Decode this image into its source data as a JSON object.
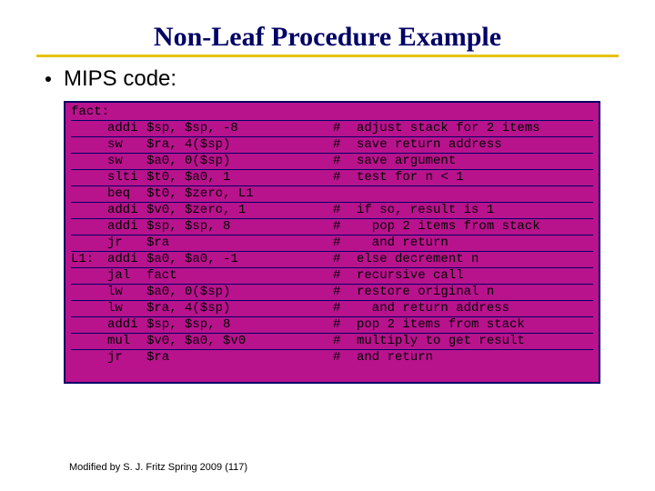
{
  "title": "Non-Leaf Procedure Example",
  "bullet": "MIPS code:",
  "code": {
    "rows": [
      {
        "label": "fact:",
        "op": "",
        "args": "",
        "hash": "",
        "comment": ""
      },
      {
        "label": "",
        "op": "addi",
        "args": "$sp, $sp, -8",
        "hash": "#",
        "comment": "adjust stack for 2 items"
      },
      {
        "label": "",
        "op": "sw",
        "args": "$ra, 4($sp)",
        "hash": "#",
        "comment": "save return address"
      },
      {
        "label": "",
        "op": "sw",
        "args": "$a0, 0($sp)",
        "hash": "#",
        "comment": "save argument"
      },
      {
        "label": "",
        "op": "slti",
        "args": "$t0, $a0, 1",
        "hash": "#",
        "comment": "test for n < 1"
      },
      {
        "label": "",
        "op": "beq",
        "args": "$t0, $zero, L1",
        "hash": "",
        "comment": ""
      },
      {
        "label": "",
        "op": "addi",
        "args": "$v0, $zero, 1",
        "hash": "#",
        "comment": "if so, result is 1"
      },
      {
        "label": "",
        "op": "addi",
        "args": "$sp, $sp, 8",
        "hash": "#",
        "comment": "  pop 2 items from stack"
      },
      {
        "label": "",
        "op": "jr",
        "args": "$ra",
        "hash": "#",
        "comment": "  and return"
      },
      {
        "label": "L1:",
        "op": "addi",
        "args": "$a0, $a0, -1",
        "hash": "#",
        "comment": "else decrement n"
      },
      {
        "label": "",
        "op": "jal",
        "args": "fact",
        "hash": "#",
        "comment": "recursive call"
      },
      {
        "label": "",
        "op": "lw",
        "args": "$a0, 0($sp)",
        "hash": "#",
        "comment": "restore original n"
      },
      {
        "label": "",
        "op": "lw",
        "args": "$ra, 4($sp)",
        "hash": "#",
        "comment": "  and return address"
      },
      {
        "label": "",
        "op": "addi",
        "args": "$sp, $sp, 8",
        "hash": "#",
        "comment": "pop 2 items from stack"
      },
      {
        "label": "",
        "op": "mul",
        "args": "$v0, $a0, $v0",
        "hash": "#",
        "comment": "multiply to get result"
      },
      {
        "label": "",
        "op": "jr",
        "args": "$ra",
        "hash": "#",
        "comment": "and return"
      }
    ]
  },
  "footer": "Modified by S. J. Fritz  Spring 2009 (117)"
}
